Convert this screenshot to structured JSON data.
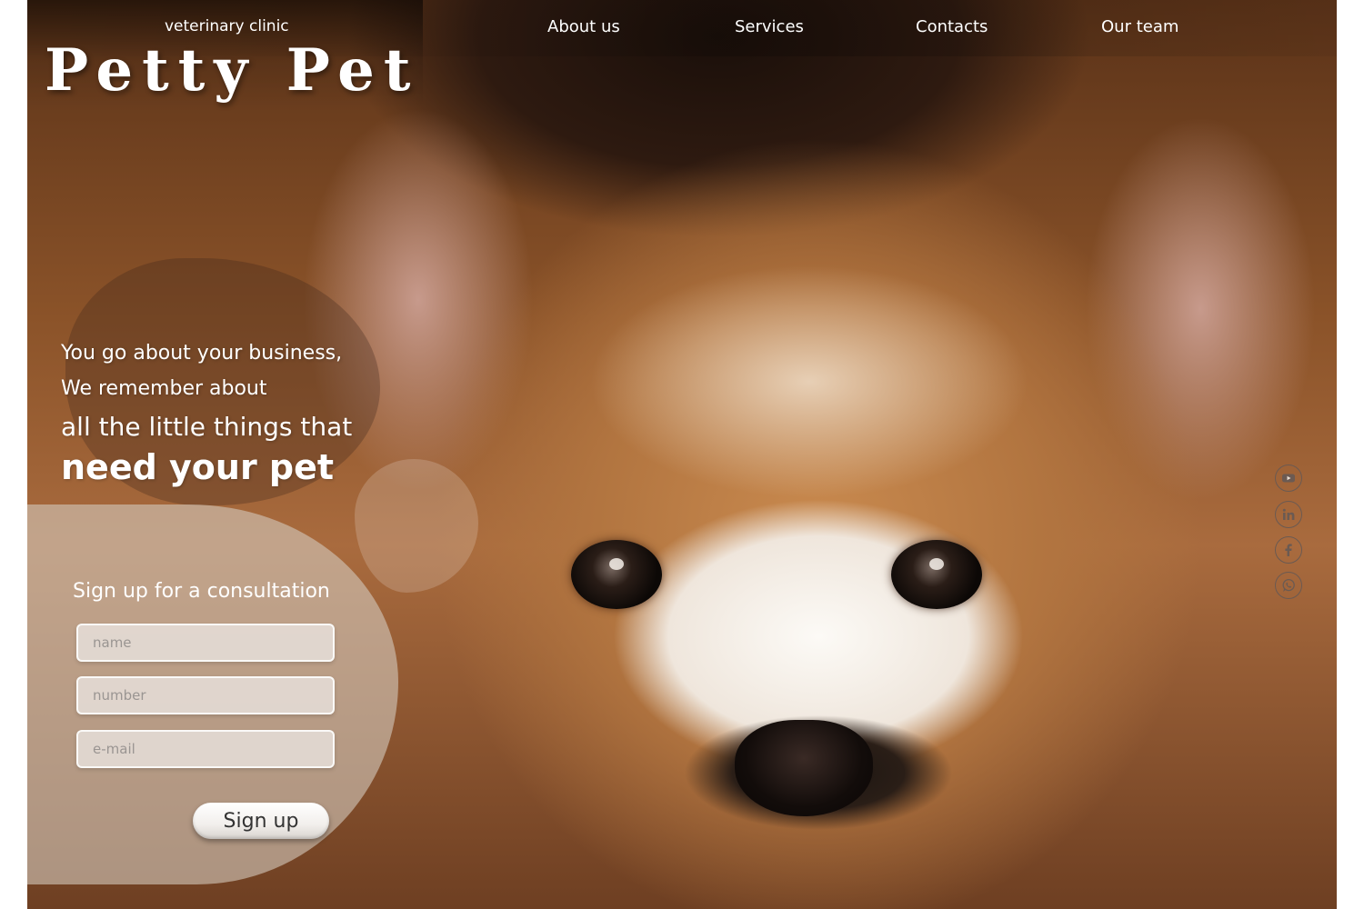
{
  "header": {
    "subtitle": "veterinary clinic",
    "brand": "Petty Pet"
  },
  "nav": {
    "items": [
      {
        "label": "About us"
      },
      {
        "label": "Services"
      },
      {
        "label": "Contacts"
      },
      {
        "label": "Our team"
      }
    ]
  },
  "hero": {
    "line1": "You go about your business,",
    "line2": "We remember about",
    "line3": "all the little things that",
    "line4": "need your pet"
  },
  "form": {
    "title": "Sign up for a consultation",
    "name_placeholder": "name",
    "number_placeholder": "number",
    "email_placeholder": "e-mail",
    "submit_label": "Sign up"
  },
  "social": {
    "icons": [
      "youtube-icon",
      "linkedin-icon",
      "facebook-icon",
      "whatsapp-icon"
    ],
    "icon_color": "#6b5a52"
  },
  "colors": {
    "text_light": "#ffffff",
    "accent_brown": "#b27540"
  }
}
